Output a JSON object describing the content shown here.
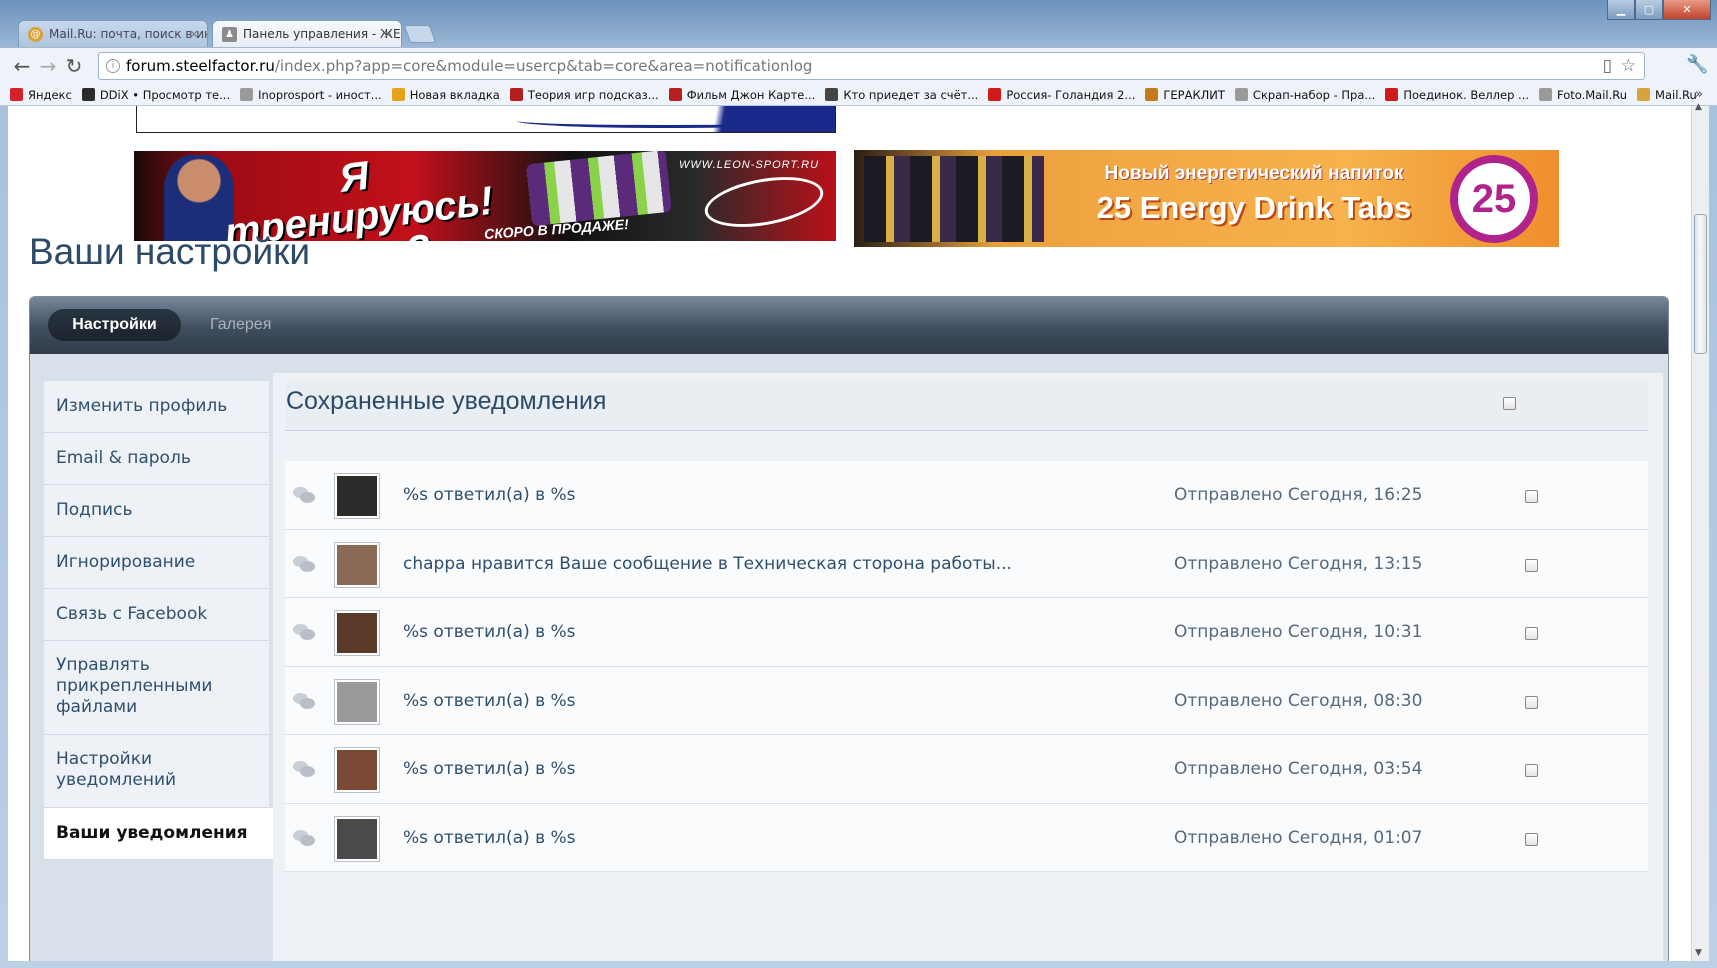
{
  "browser": {
    "tabs": [
      {
        "title": "Mail.Ru: почта, поиск в ин",
        "active": false
      },
      {
        "title": "Панель управления - ЖЕЛ",
        "active": true
      }
    ],
    "url_domain": "forum.steelfactor.ru",
    "url_path": "/index.php?app=core&module=usercp&tab=core&area=notificationlog",
    "bookmarks": [
      {
        "label": "Яндекс",
        "color": "#d8202a"
      },
      {
        "label": "DDiX • Просмотр те...",
        "color": "#2b2b2b"
      },
      {
        "label": "Inoprosport - иност...",
        "color": "#9a9a9a"
      },
      {
        "label": "Новая вкладка",
        "color": "#e6a21a"
      },
      {
        "label": "Теория игр подсказ...",
        "color": "#b51e1e"
      },
      {
        "label": "Фильм Джон Карте...",
        "color": "#b5201e"
      },
      {
        "label": "Кто приедет за счёт...",
        "color": "#444444"
      },
      {
        "label": "Россия- Голандия 2...",
        "color": "#d11b1b"
      },
      {
        "label": "ГЕРАКЛИТ",
        "color": "#c47a1e"
      },
      {
        "label": "Скрап-набор - Пра...",
        "color": "#9a9a9a"
      },
      {
        "label": "Поединок. Веллер ...",
        "color": "#d11b1b"
      },
      {
        "label": "Foto.Mail.Ru",
        "color": "#9a9a9a"
      },
      {
        "label": "Mail.Ru",
        "color": "#d9a23d"
      }
    ]
  },
  "banners": {
    "left": {
      "headline": "Я тренируюсь! А ты?",
      "sub": "СКОРО В ПРОДАЖЕ!",
      "site": "WWW.LEON-SPORT.RU"
    },
    "right": {
      "line1": "Новый энергетический напиток",
      "line2": "25 Energy Drink Tabs",
      "badge": "25"
    }
  },
  "page": {
    "title": "Ваши настройки",
    "tabs": {
      "settings": "Настройки",
      "gallery": "Галерея"
    }
  },
  "sidebar": {
    "items": [
      {
        "label": "Изменить профиль",
        "active": false
      },
      {
        "label": "Email & пароль",
        "active": false
      },
      {
        "label": "Подпись",
        "active": false
      },
      {
        "label": "Игнорирование",
        "active": false
      },
      {
        "label": "Связь с Facebook",
        "active": false
      },
      {
        "label": "Управлять прикрепленными файлами",
        "active": false
      },
      {
        "label": "Настройки уведомлений",
        "active": false
      },
      {
        "label": "Ваши уведомления",
        "active": true
      }
    ]
  },
  "notifications": {
    "title": "Сохраненные уведомления",
    "rows": [
      {
        "message": "%s ответил(а) в %s",
        "sent": "Отправлено Сегодня, 16:25",
        "avatar_color": "#2c2c2c"
      },
      {
        "message": "chappa нравится Ваше сообщение в Техническая сторона работы...",
        "sent": "Отправлено Сегодня, 13:15",
        "avatar_color": "#8a6a55"
      },
      {
        "message": "%s ответил(а) в %s",
        "sent": "Отправлено Сегодня, 10:31",
        "avatar_color": "#5b3a2a"
      },
      {
        "message": "%s ответил(а) в %s",
        "sent": "Отправлено Сегодня, 08:30",
        "avatar_color": "#9a9a9a"
      },
      {
        "message": "%s ответил(а) в %s",
        "sent": "Отправлено Сегодня, 03:54",
        "avatar_color": "#7a4a35"
      },
      {
        "message": "%s ответил(а) в %s",
        "sent": "Отправлено Сегодня, 01:07",
        "avatar_color": "#4a4a4a"
      }
    ]
  }
}
